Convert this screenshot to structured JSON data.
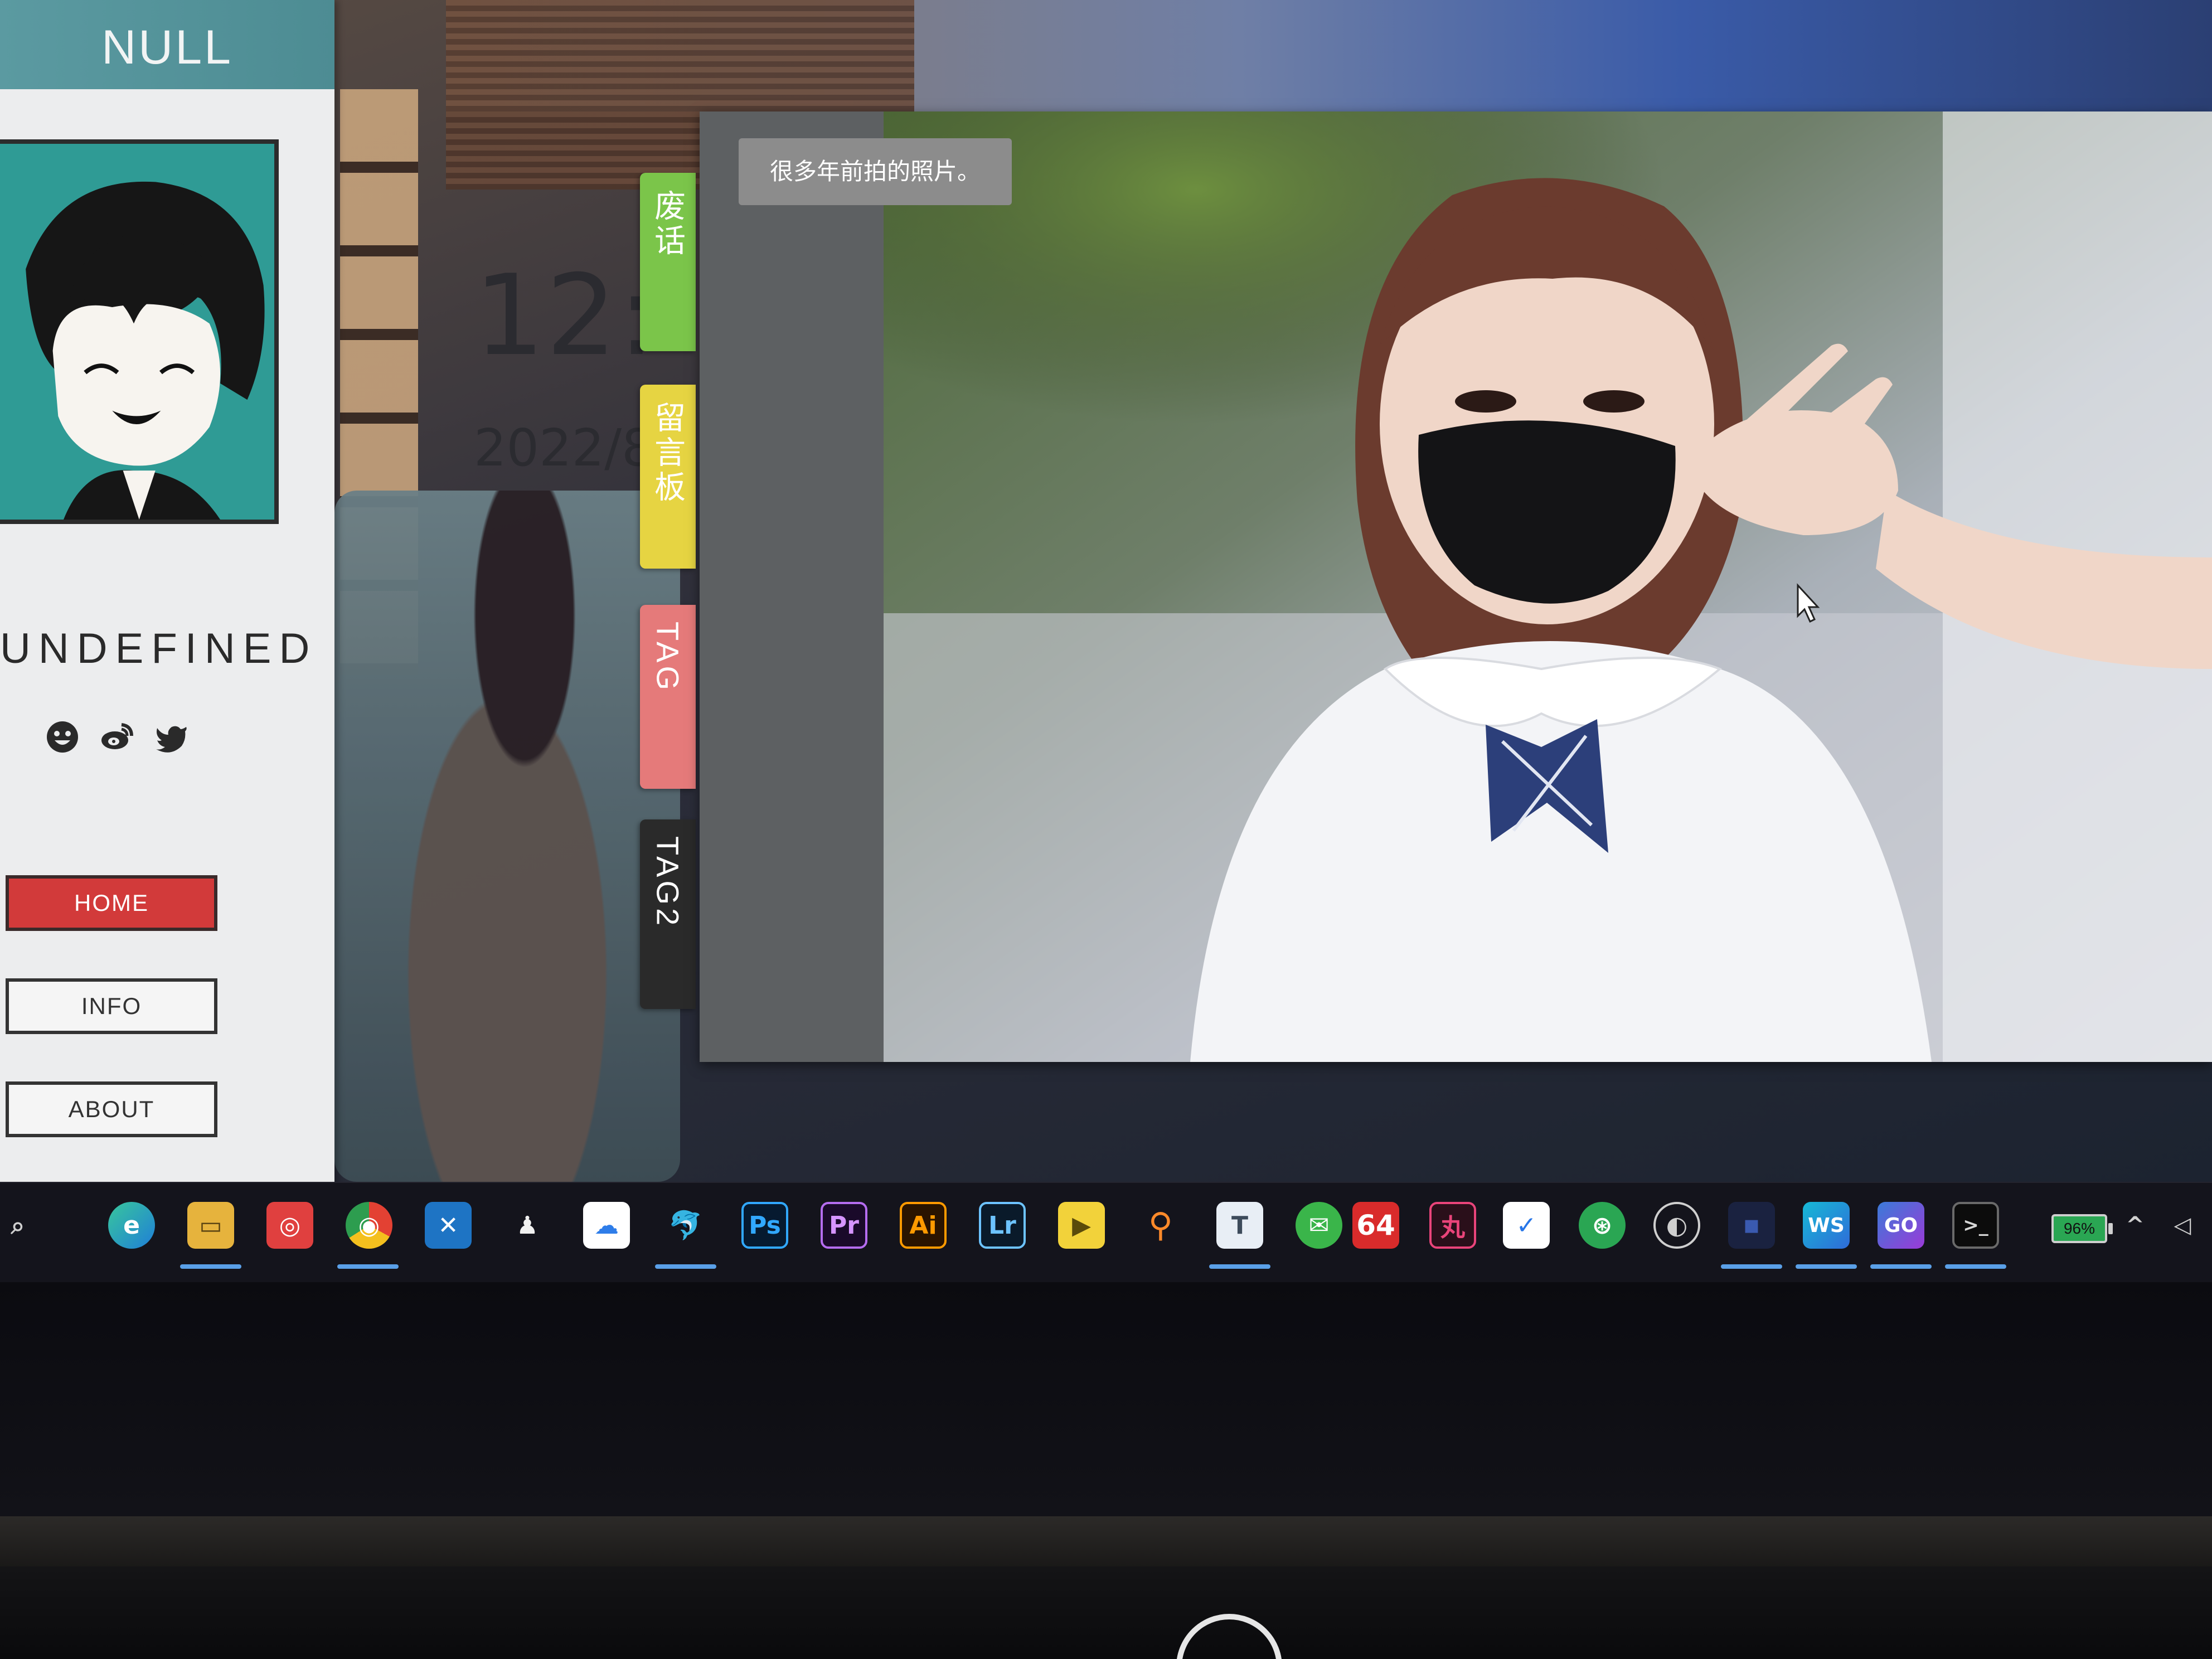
{
  "sidebar": {
    "title": "NULL",
    "name": "UNDEFINED",
    "social_icons": [
      "emoji-icon",
      "weibo-icon",
      "twitter-icon"
    ],
    "nav": [
      {
        "label": "HOME",
        "active": true
      },
      {
        "label": "INFO",
        "active": false
      },
      {
        "label": "ABOUT",
        "active": false
      }
    ]
  },
  "desktop": {
    "clock_time": "12:",
    "clock_date": "2022/8"
  },
  "tabs": [
    {
      "label": "废话",
      "color": "#7bc54a"
    },
    {
      "label": "留言板",
      "color": "#e6d442"
    },
    {
      "label": "TAG",
      "color": "#e57a7a"
    },
    {
      "label": "TAG2",
      "color": "#2a2a2a"
    }
  ],
  "post": {
    "caption": "很多年前拍的照片。"
  },
  "taskbar": {
    "icons": [
      {
        "name": "search-icon",
        "text": "⌕"
      },
      {
        "name": "edge-icon",
        "text": "e"
      },
      {
        "name": "file-explorer-icon",
        "text": "▭"
      },
      {
        "name": "netease-music-icon",
        "text": "◎"
      },
      {
        "name": "chrome-icon",
        "text": "◉"
      },
      {
        "name": "vscode-icon",
        "text": "✕"
      },
      {
        "name": "qq-icon",
        "text": "♟"
      },
      {
        "name": "baidu-netdisk-icon",
        "text": "☁"
      },
      {
        "name": "mysql-icon",
        "text": "🐬"
      },
      {
        "name": "photoshop-icon",
        "text": "Ps"
      },
      {
        "name": "premiere-icon",
        "text": "Pr"
      },
      {
        "name": "illustrator-icon",
        "text": "Ai"
      },
      {
        "name": "lightroom-icon",
        "text": "Lr"
      },
      {
        "name": "potplayer-icon",
        "text": "▶"
      },
      {
        "name": "everything-search-icon",
        "text": "⚲"
      },
      {
        "name": "typora-icon",
        "text": "T"
      },
      {
        "name": "wechat-icon",
        "text": "✉"
      },
      {
        "name": "aida64-icon",
        "text": "64"
      },
      {
        "name": "xmind-icon",
        "text": "丸"
      },
      {
        "name": "todo-icon",
        "text": "✓"
      },
      {
        "name": "greenshot-icon",
        "text": "⊛"
      },
      {
        "name": "obs-icon",
        "text": "◐"
      },
      {
        "name": "app-blue-icon",
        "text": "■"
      },
      {
        "name": "webstorm-icon",
        "text": "WS"
      },
      {
        "name": "goland-icon",
        "text": "GO"
      },
      {
        "name": "terminal-icon",
        "text": ">_"
      }
    ],
    "battery": "96%"
  },
  "colors": {
    "accent": "#4d8c93",
    "active_nav": "#d23a3a"
  }
}
